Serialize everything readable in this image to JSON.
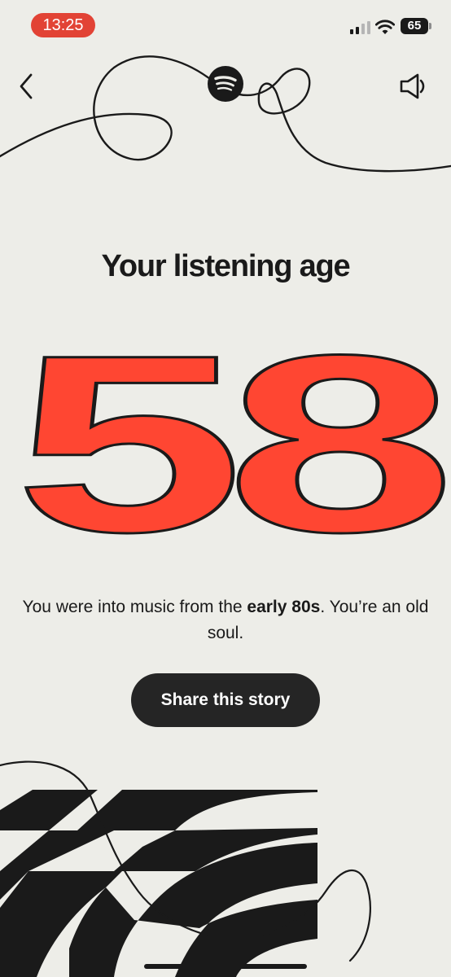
{
  "status_bar": {
    "time": "13:25",
    "battery": "65"
  },
  "header": {
    "back_icon": "chevron-left-icon",
    "logo_icon": "spotify-logo-icon",
    "sound_icon": "speaker-icon"
  },
  "story": {
    "headline": "Your listening age",
    "age": "58",
    "description_before": "You were into music from the ",
    "description_bold": "early 80s",
    "description_after": ". You’re an old soul.",
    "share_label": "Share this story"
  },
  "colors": {
    "background": "#EDEDE8",
    "age_fill": "#FF4632",
    "ink": "#1A1A1A",
    "button": "#252525",
    "time_pill": "#E24335"
  }
}
